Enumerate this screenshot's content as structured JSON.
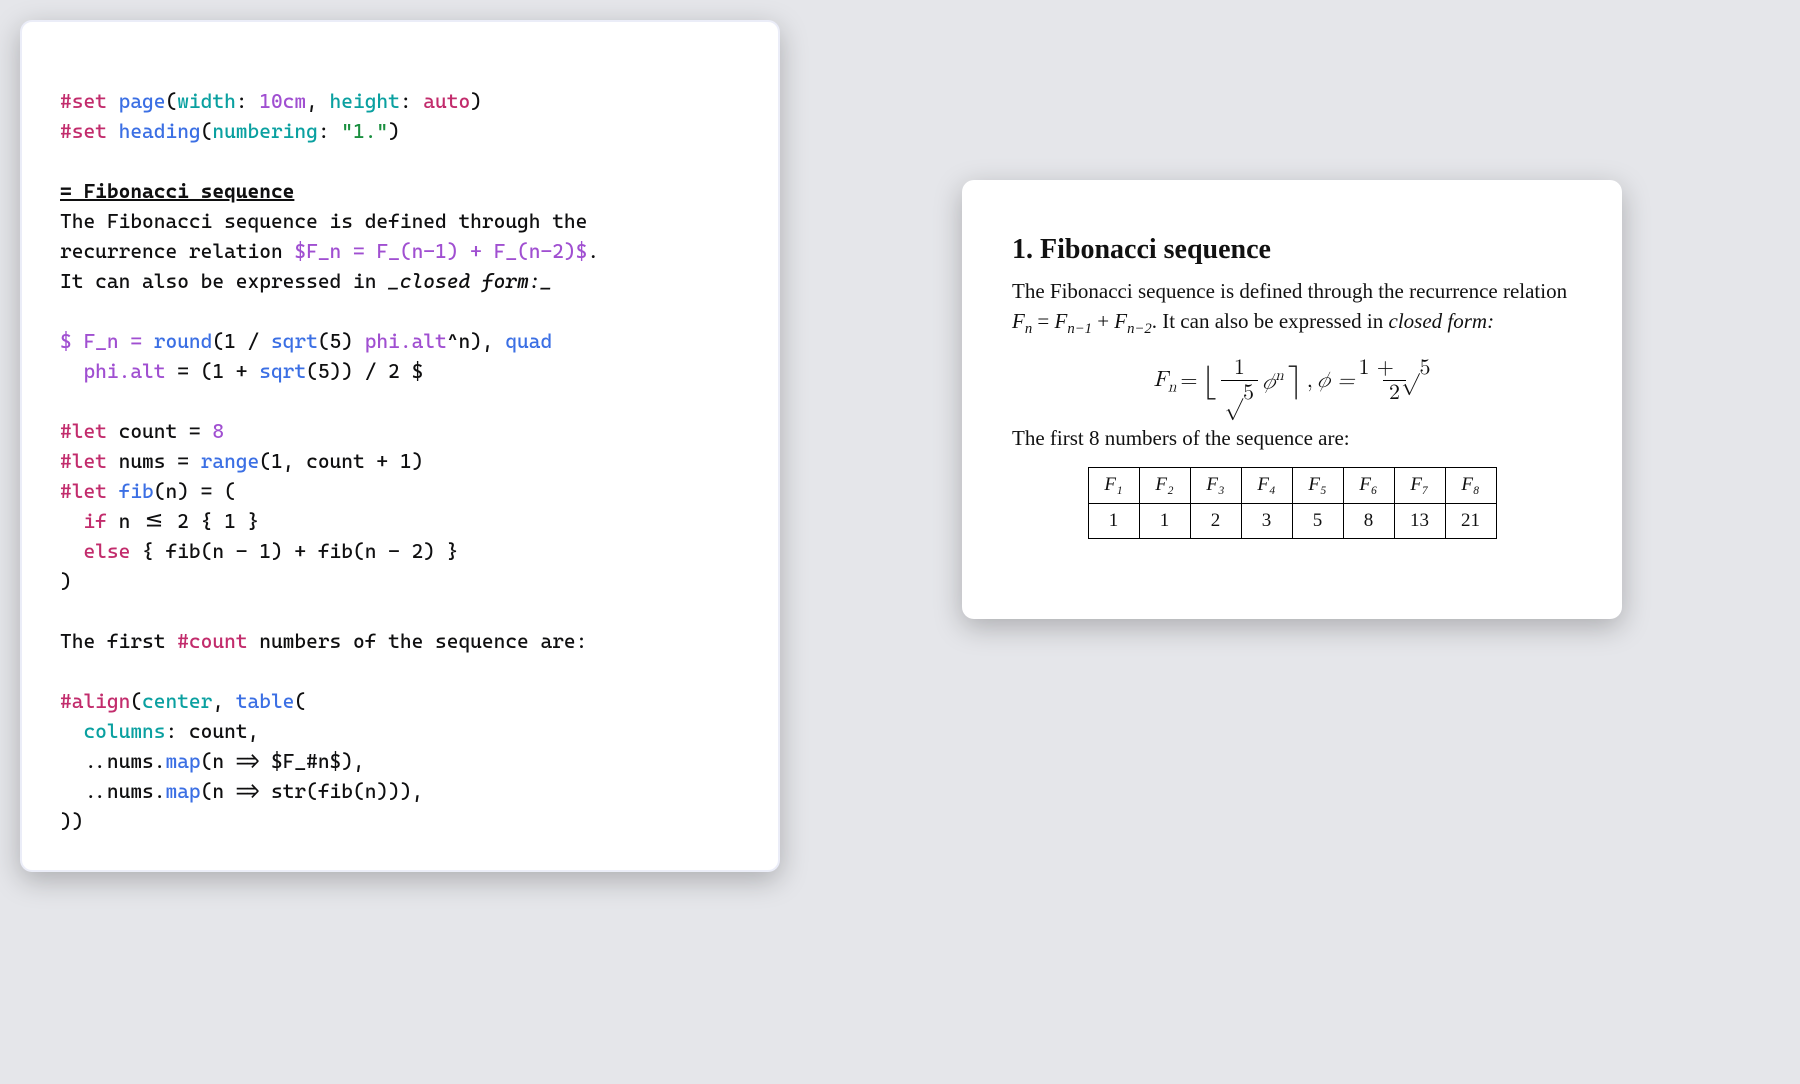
{
  "code": {
    "l1_set": "#set",
    "l1_page": "page",
    "l1_width": "width",
    "l1_widthv": "10cm",
    "l1_height": "height",
    "l1_heightv": "auto",
    "l2_heading": "heading",
    "l2_numbering": "numbering",
    "l2_numval": "\"1.\"",
    "heading_line": "= Fibonacci sequence",
    "para1_a": "The Fibonacci sequence is defined through the",
    "para1_b": "recurrence relation ",
    "math_inline": "$F_n = F_(n-1) + F_(n-2)$",
    "para1_c": ".",
    "para2": "It can also be expressed in ",
    "para2_em": "_closed form:_",
    "mblock_a": "$ F_n = ",
    "mblock_round": "round",
    "mblock_b": "(1 / ",
    "mblock_sqrt": "sqrt",
    "mblock_c": "(5) ",
    "mblock_phi": "phi.alt",
    "mblock_d": "^n), ",
    "mblock_quad": "quad",
    "mblock_e": "  phi.alt",
    "mblock_f": " = (1 + ",
    "mblock_g": "(5)) / 2 $",
    "let_kw": "#let",
    "count_name": "count",
    "count_val": "8",
    "nums_name": "nums",
    "range_fn": "range",
    "range_args": "(1, count + 1)",
    "fib_name": "fib",
    "fib_sig": "(n) = (",
    "if_kw": "if",
    "if_cond": " n <= 2 { 1 }",
    "else_kw": "else",
    "else_body": " { fib(n - 1) + fib(n - 2) }",
    "close_paren": ")",
    "first_line_a": "The first ",
    "first_line_b": "#count",
    "first_line_c": " numbers of the sequence are:",
    "align_kw": "#align",
    "align_args_a": "(",
    "align_center": "center",
    "table_fn": "table",
    "align_args_b": "(",
    "columns_key": "columns",
    "columns_val": ": count,",
    "map1_a": "  ..nums.",
    "map_fn": "map",
    "map1_b": "(n => $F_#n$),",
    "map2_b": "(n => str(fib(n))),",
    "close2": "))"
  },
  "render": {
    "heading": "1. Fibonacci sequence",
    "para_a": "The Fibonacci sequence is defined through the recurrence relation ",
    "rel_F": "F",
    "rel_n": "n",
    "rel_eq": " = ",
    "rel_nm1": "n−1",
    "rel_plus": " + ",
    "rel_nm2": "n−2",
    "para_b": ". It can also be expressed in ",
    "closed_form": "closed form:",
    "eq_Fn": "F",
    "eq_sub_n": "n",
    "eq_eq": " = ",
    "eq_floor_l": "⌊",
    "eq_frac_top1": "1",
    "eq_frac_bot1": "√5",
    "eq_phi": "𝜙",
    "eq_supn": "n",
    "eq_rceil": "⌉",
    "eq_comma": ",   ",
    "eq_phi2": "𝜙 = ",
    "eq_frac_top2": "1 + √5",
    "eq_frac_bot2": "2",
    "first8": "The first 8 numbers of the sequence are:",
    "table": {
      "headers": [
        "F₁",
        "F₂",
        "F₃",
        "F₄",
        "F₅",
        "F₆",
        "F₇",
        "F₈"
      ],
      "values": [
        "1",
        "1",
        "2",
        "3",
        "5",
        "8",
        "13",
        "21"
      ]
    }
  }
}
